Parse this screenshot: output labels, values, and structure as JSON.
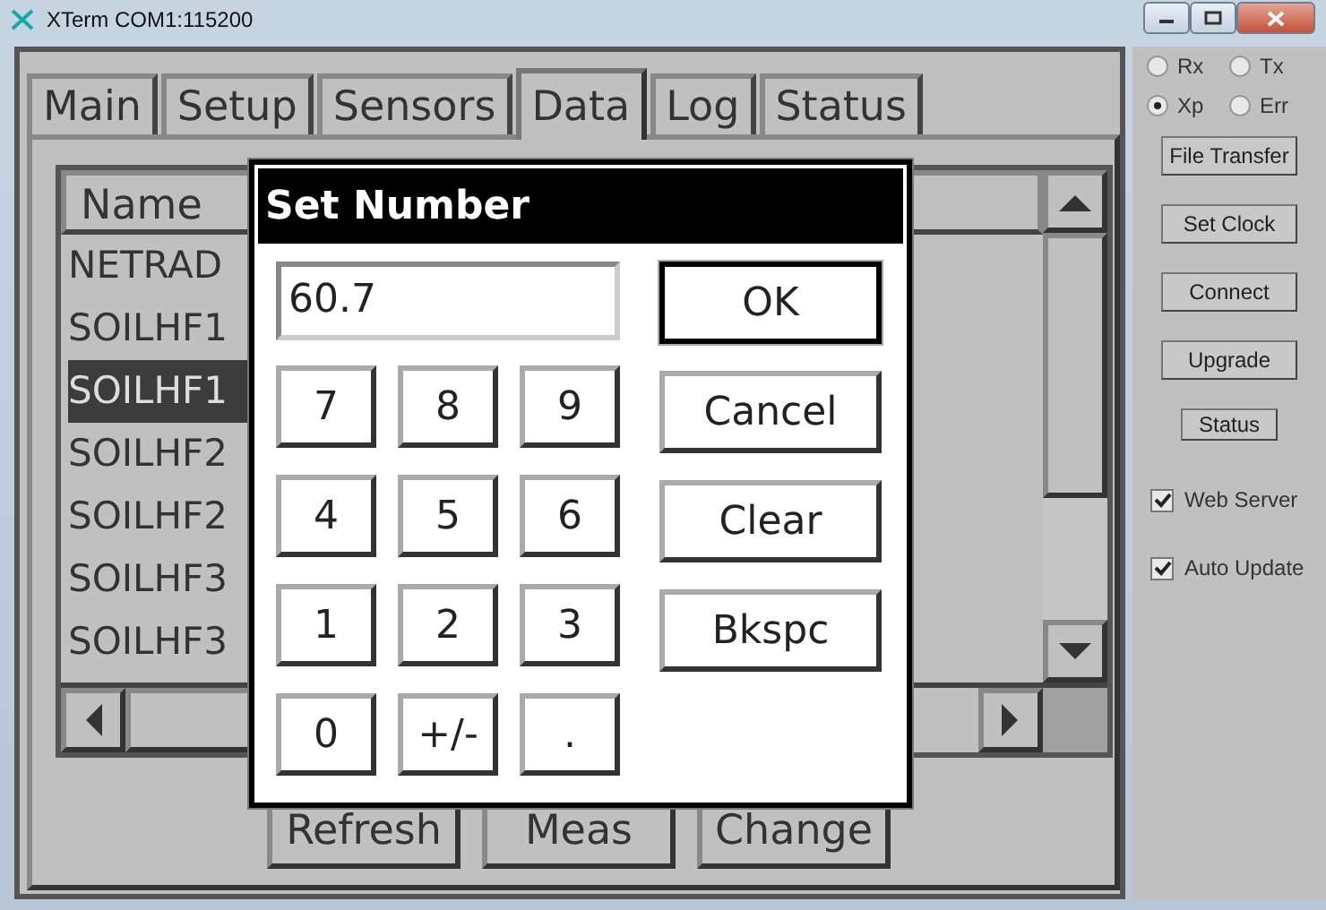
{
  "window": {
    "title": "XTerm COM1:115200"
  },
  "tabs": [
    {
      "label": "Main",
      "selected": false
    },
    {
      "label": "Setup",
      "selected": false
    },
    {
      "label": "Sensors",
      "selected": false
    },
    {
      "label": "Data",
      "selected": true
    },
    {
      "label": "Log",
      "selected": false
    },
    {
      "label": "Status",
      "selected": false
    }
  ],
  "list": {
    "column": "Name",
    "rows": [
      {
        "text": "NETRAD",
        "selected": false
      },
      {
        "text": "SOILHF1",
        "selected": false
      },
      {
        "text": "SOILHF1",
        "selected": true
      },
      {
        "text": "SOILHF2",
        "selected": false
      },
      {
        "text": "SOILHF2",
        "selected": false
      },
      {
        "text": "SOILHF3",
        "selected": false
      },
      {
        "text": "SOILHF3",
        "selected": false
      }
    ]
  },
  "buttons": [
    "Refresh",
    "Meas",
    "Change"
  ],
  "dialog": {
    "title": "Set Number",
    "value": "60.7",
    "keys": [
      "7",
      "8",
      "9",
      "4",
      "5",
      "6",
      "1",
      "2",
      "3",
      "0",
      "+/-",
      "."
    ],
    "actions": [
      "OK",
      "Cancel",
      "Clear",
      "Bkspc"
    ]
  },
  "indicators": [
    {
      "label": "Rx",
      "selected": false
    },
    {
      "label": "Tx",
      "selected": false
    },
    {
      "label": "Xp",
      "selected": true
    },
    {
      "label": "Err",
      "selected": false
    }
  ],
  "side_buttons": [
    {
      "label": "File Transfer",
      "kind": "wide"
    },
    {
      "label": "Set Clock",
      "kind": "wide"
    },
    {
      "label": "Connect",
      "kind": "wide"
    },
    {
      "label": "Upgrade",
      "kind": "wide"
    },
    {
      "label": "Status",
      "kind": "small"
    }
  ],
  "options": [
    {
      "label": "Web Server",
      "checked": true
    },
    {
      "label": "Auto Update",
      "checked": true
    }
  ]
}
